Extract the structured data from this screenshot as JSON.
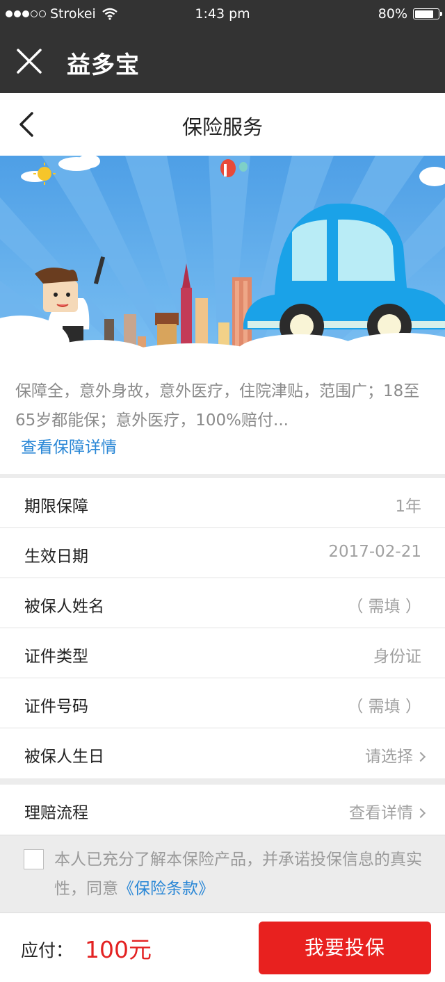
{
  "status_bar": {
    "carrier": "Strokei",
    "time": "1:43 pm",
    "battery": "80%",
    "battery_level": 0.8,
    "signal_icon": "signal-dots-icon",
    "wifi_icon": "wifi-icon"
  },
  "app_bar": {
    "title": "益多宝",
    "close_icon": "close-icon"
  },
  "nav": {
    "title": "保险服务",
    "back_icon": "chevron-left-icon"
  },
  "description": {
    "text": "保障全，意外身故，意外医疗，住院津贴，范围广；18至65岁都能保；意外医疗，100%赔付...",
    "link": "查看保障详情"
  },
  "form": {
    "rows": [
      {
        "label": "期限保障",
        "value": "1年"
      },
      {
        "label": "生效日期",
        "value": "2017-02-21"
      },
      {
        "label": "被保人姓名",
        "value": "（ 需填 ）"
      },
      {
        "label": "证件类型",
        "value": "身份证"
      },
      {
        "label": "证件号码",
        "value": "（ 需填 ）"
      },
      {
        "label": "被保人生日",
        "value": "请选择"
      }
    ]
  },
  "claims": {
    "label": "理赔流程",
    "value": "查看详情"
  },
  "agreement": {
    "text": "本人已充分了解本保险产品，并承诺投保信息的真实性，同意",
    "terms": "《保险条款》"
  },
  "footer": {
    "pay_label": "应付：",
    "amount": "100元",
    "submit": "我要投保"
  },
  "colors": {
    "header_bg": "#333333",
    "accent_red": "#e8211f",
    "link_blue": "#2a87d6",
    "banner_sky": "#5aa7ea"
  }
}
